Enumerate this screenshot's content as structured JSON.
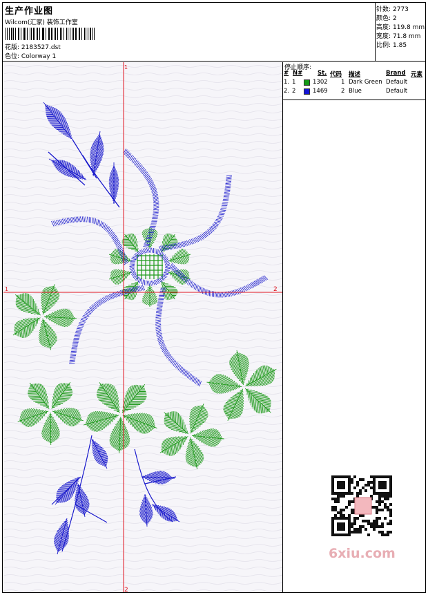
{
  "header": {
    "title": "生产作业图",
    "company": "Wilcom(汇家) 装饰工作室",
    "design_label": "花版:",
    "design_value": "2183527.dst",
    "colorway_label": "色位:",
    "colorway_value": "Colorway 1"
  },
  "stats": [
    {
      "label": "针数:",
      "value": "2773"
    },
    {
      "label": "颜色:",
      "value": "2"
    },
    {
      "label": "高度:",
      "value": "119.8 mm"
    },
    {
      "label": "宽度:",
      "value": "71.8 mm"
    },
    {
      "label": "比例:",
      "value": "1.85"
    }
  ],
  "canvas": {
    "axis_top": "1",
    "axis_left": "1",
    "axis_right": "2",
    "axis_bottom": "2",
    "colors": {
      "green": "#1f9a1c",
      "blue": "#1a1acc",
      "axis": "#e0141e"
    }
  },
  "stop_sequence": {
    "title": "停止顺序:",
    "headers": {
      "num": "#",
      "no": "N#",
      "st": "St.",
      "code": "代码",
      "desc": "描述",
      "brand": "Brand",
      "elem": "元素"
    },
    "rows": [
      {
        "num": "1.",
        "no": "1",
        "color": "#139a16",
        "st": "1302",
        "code": "1",
        "desc": "Dark Green",
        "brand": "Default"
      },
      {
        "num": "2.",
        "no": "2",
        "color": "#1414d8",
        "st": "1469",
        "code": "2",
        "desc": "Blue",
        "brand": "Default"
      }
    ]
  },
  "watermark": "6xiu.com"
}
